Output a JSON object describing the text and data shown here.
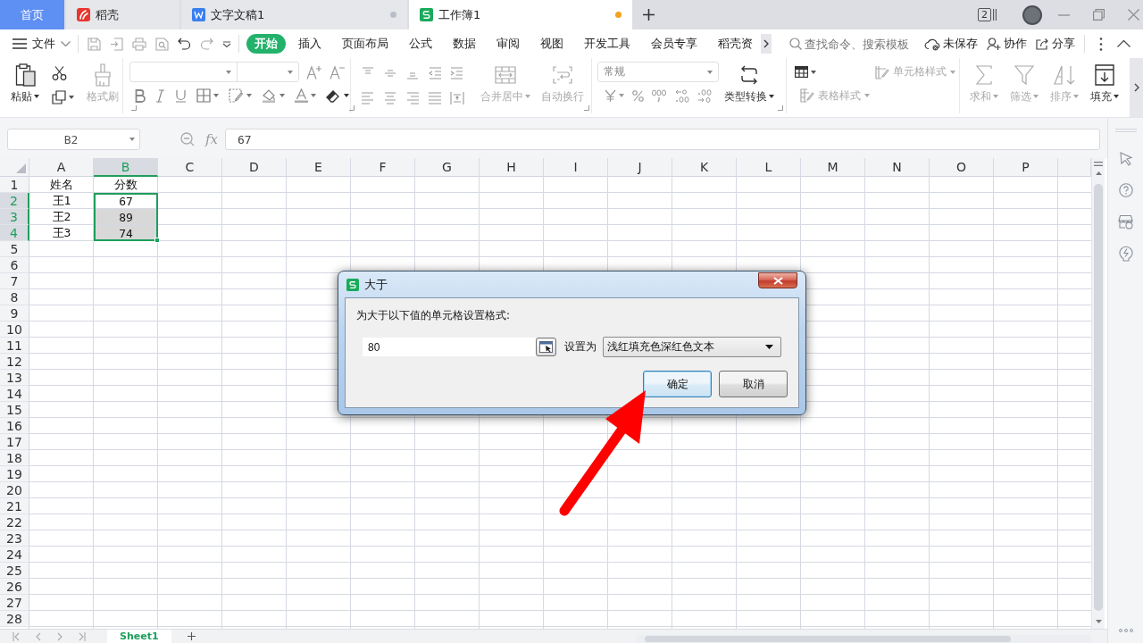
{
  "tabs": [
    {
      "label": "首页",
      "kind": "home",
      "selected": false,
      "unsaved": false
    },
    {
      "label": "稻壳",
      "kind": "docer",
      "selected": false,
      "unsaved": false
    },
    {
      "label": "文字文稿1",
      "kind": "writer",
      "selected": false,
      "unsaved": true
    },
    {
      "label": "工作簿1",
      "kind": "sheet",
      "selected": true,
      "unsaved": true
    }
  ],
  "window_count": "2",
  "menu": {
    "file": "文件",
    "ribbon_tabs": [
      {
        "label": "开始",
        "selected": true
      },
      {
        "label": "插入",
        "selected": false
      },
      {
        "label": "页面布局",
        "selected": false
      },
      {
        "label": "公式",
        "selected": false
      },
      {
        "label": "数据",
        "selected": false
      },
      {
        "label": "审阅",
        "selected": false
      },
      {
        "label": "视图",
        "selected": false
      },
      {
        "label": "开发工具",
        "selected": false
      },
      {
        "label": "会员专享",
        "selected": false
      },
      {
        "label": "稻壳资",
        "selected": false
      }
    ],
    "search_placeholder": "查找命令、搜索模板",
    "actions": [
      {
        "label": "未保存",
        "kind": "cloud"
      },
      {
        "label": "协作",
        "kind": "collab"
      },
      {
        "label": "分享",
        "kind": "share"
      }
    ]
  },
  "ribbon": {
    "paste": {
      "label": "粘贴",
      "disabled": false
    },
    "format_painter": {
      "label": "格式刷",
      "disabled": true
    },
    "merge_center": {
      "label": "合并居中",
      "disabled": true
    },
    "wrap_text": {
      "label": "自动换行",
      "disabled": true
    },
    "number_format": "常规",
    "type_convert": {
      "label": "类型转换",
      "disabled": false
    },
    "cell_style": {
      "label": "单元格样式",
      "disabled": true
    },
    "table_style": {
      "label": "表格样式",
      "disabled": true
    },
    "tools": [
      {
        "label": "求和",
        "kind": "sum",
        "disabled": true
      },
      {
        "label": "筛选",
        "kind": "filter",
        "disabled": true
      },
      {
        "label": "排序",
        "kind": "sort",
        "disabled": true
      },
      {
        "label": "填充",
        "kind": "fill",
        "disabled": false
      }
    ]
  },
  "formula_bar": {
    "cell_ref": "B2",
    "function_label": "fx",
    "formula": "67"
  },
  "sheet": {
    "columns": [
      {
        "label": "A",
        "selected": false
      },
      {
        "label": "B",
        "selected": true
      },
      {
        "label": "C",
        "selected": false
      },
      {
        "label": "D",
        "selected": false
      },
      {
        "label": "E",
        "selected": false
      },
      {
        "label": "F",
        "selected": false
      },
      {
        "label": "G",
        "selected": false
      },
      {
        "label": "H",
        "selected": false
      },
      {
        "label": "I",
        "selected": false
      },
      {
        "label": "J",
        "selected": false
      },
      {
        "label": "K",
        "selected": false
      },
      {
        "label": "L",
        "selected": false
      },
      {
        "label": "M",
        "selected": false
      },
      {
        "label": "N",
        "selected": false
      },
      {
        "label": "O",
        "selected": false
      },
      {
        "label": "P",
        "selected": false
      }
    ],
    "rows": [
      {
        "label": "1",
        "selected": false,
        "cells": [
          {
            "text": "姓名",
            "selected": false,
            "active": false
          },
          {
            "text": "分数",
            "selected": false,
            "active": false
          }
        ]
      },
      {
        "label": "2",
        "selected": true,
        "cells": [
          {
            "text": "王1",
            "selected": false,
            "active": false
          },
          {
            "text": "67",
            "selected": true,
            "active": true
          }
        ]
      },
      {
        "label": "3",
        "selected": true,
        "cells": [
          {
            "text": "王2",
            "selected": false,
            "active": false
          },
          {
            "text": "89",
            "selected": true,
            "active": false
          }
        ]
      },
      {
        "label": "4",
        "selected": true,
        "cells": [
          {
            "text": "王3",
            "selected": false,
            "active": false
          },
          {
            "text": "74",
            "selected": true,
            "active": false
          }
        ]
      },
      {
        "label": "5",
        "selected": false
      },
      {
        "label": "6",
        "selected": false
      },
      {
        "label": "7",
        "selected": false
      },
      {
        "label": "8",
        "selected": false
      },
      {
        "label": "9",
        "selected": false
      },
      {
        "label": "10",
        "selected": false
      },
      {
        "label": "11",
        "selected": false
      },
      {
        "label": "12",
        "selected": false
      },
      {
        "label": "13",
        "selected": false
      },
      {
        "label": "14",
        "selected": false
      },
      {
        "label": "15",
        "selected": false
      },
      {
        "label": "16",
        "selected": false
      },
      {
        "label": "17",
        "selected": false
      },
      {
        "label": "18",
        "selected": false
      },
      {
        "label": "19",
        "selected": false
      },
      {
        "label": "20",
        "selected": false
      },
      {
        "label": "21",
        "selected": false
      },
      {
        "label": "22",
        "selected": false
      },
      {
        "label": "23",
        "selected": false
      },
      {
        "label": "24",
        "selected": false
      },
      {
        "label": "25",
        "selected": false
      },
      {
        "label": "26",
        "selected": false
      },
      {
        "label": "27",
        "selected": false
      },
      {
        "label": "28",
        "selected": false
      }
    ],
    "tabs": [
      {
        "label": "Sheet1",
        "selected": true
      }
    ]
  },
  "dialog": {
    "title": "大于",
    "prompt": "为大于以下值的单元格设置格式:",
    "value": "80",
    "format_label": "设置为",
    "format": "浅红填充色深红色文本",
    "buttons": [
      {
        "label": "确定",
        "focused": true
      },
      {
        "label": "取消",
        "focused": false
      }
    ]
  }
}
